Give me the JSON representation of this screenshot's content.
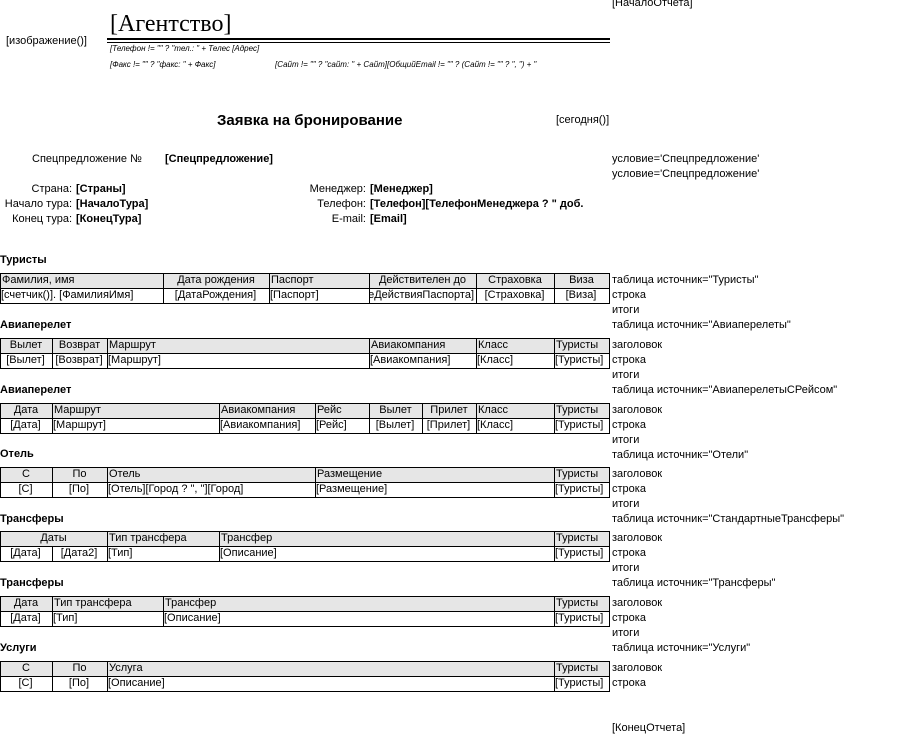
{
  "top_right": "[НачалоОтчета]",
  "bottom_right": "[КонецОтчета]",
  "header": {
    "image": "[изображение()]",
    "agency": "[Агентство]",
    "line1": "[Телефон != \"\" ? \"тел.:  \" + Телес [Адрес]",
    "line2a": "[Факс != \"\" ? \"факс: \" + Факс]",
    "line2b": "[Сайт != \"\" ? \"сайт: \" + Сайт][ОбщийEmail != \"\" ? (Сайт != \"\" ? \", \") + \""
  },
  "title": "Заявка на бронирование",
  "today": "[сегодня()]",
  "special": {
    "label": "Спецпредложение №",
    "value": "[Спецпредложение]"
  },
  "conditions": [
    "условие='Спецпредложение'",
    "условие='Спецпредложение'"
  ],
  "info": {
    "country_label": "Страна:",
    "country": "[Страны]",
    "start_label": "Начало тура:",
    "start": "[НачалоТура]",
    "end_label": "Конец тура:",
    "end": "[КонецТура]",
    "manager_label": "Менеджер:",
    "manager": "[Менеджер]",
    "phone_label": "Телефон:",
    "phone": "[Телефон][ТелефонМенеджера ? \" доб.",
    "email_label": "E-mail:",
    "email": "[Email]"
  },
  "sections": {
    "tourists": {
      "title": "Туристы",
      "headers": [
        "Фамилия, имя",
        "Дата рождения",
        "Паспорт",
        "Действителен до",
        "Страховка",
        "Виза"
      ],
      "row": [
        "[счетчик()]. [ФамилияИмя]",
        "[ДатаРождения]",
        "[Паспорт]",
        "[ОкончаниеДействияПаспорта]",
        "[Страховка]",
        "[Виза]"
      ]
    },
    "air1": {
      "title": "Авиаперелет",
      "headers": [
        "Вылет",
        "Возврат",
        "Маршрут",
        "Авиакомпания",
        "Класс",
        "Туристы"
      ],
      "row": [
        "[Вылет]",
        "[Возврат]",
        "[Маршрут]",
        "[Авиакомпания]",
        "[Класс]",
        "[Туристы]"
      ]
    },
    "air2": {
      "title": "Авиаперелет",
      "headers": [
        "Дата",
        "Маршрут",
        "Авиакомпания",
        "Рейс",
        "Вылет",
        "Прилет",
        "Класс",
        "Туристы"
      ],
      "row": [
        "[Дата]",
        "[Маршрут]",
        "[Авиакомпания]",
        "[Рейс]",
        "[Вылет]",
        "[Прилет]",
        "[Класс]",
        "[Туристы]"
      ]
    },
    "hotel": {
      "title": "Отель",
      "headers": [
        "С",
        "По",
        "Отель",
        "Размещение",
        "Туристы"
      ],
      "row": [
        "[С]",
        "[По]",
        "[Отель][Город ? \", \"][Город]",
        "[Размещение]",
        "[Туристы]"
      ]
    },
    "transfer1": {
      "title": "Трансферы",
      "headers": [
        "Даты",
        "Тип трансфера",
        "Трансфер",
        "Туристы"
      ],
      "row": [
        "[Дата]",
        "[Дата2]",
        "[Тип]",
        "[Описание]",
        "[Туристы]"
      ]
    },
    "transfer2": {
      "title": "Трансферы",
      "headers": [
        "Дата",
        "Тип трансфера",
        "Трансфер",
        "Туристы"
      ],
      "row": [
        "[Дата]",
        "[Тип]",
        "[Описание]",
        "[Туристы]"
      ]
    },
    "services": {
      "title": "Услуги",
      "headers": [
        "С",
        "По",
        "Услуга",
        "Туристы"
      ],
      "row": [
        "[С]",
        "[По]",
        "[Описание]",
        "[Туристы]"
      ]
    }
  },
  "side_notes": {
    "t_tourists": "таблица источник=\"Туристы\"",
    "t_air1": "таблица источник=\"Авиаперелеты\"",
    "t_air2": "таблица источник=\"АвиаперелетыСРейсом\"",
    "t_hotel": "таблица источник=\"Отели\"",
    "t_transfer1": "таблица источник=\"СтандартныеТрансферы\"",
    "t_transfer2": "таблица источник=\"Трансферы\"",
    "t_services": "таблица источник=\"Услуги\"",
    "header": "заголовок",
    "row": "строка",
    "totals": "итоги"
  }
}
